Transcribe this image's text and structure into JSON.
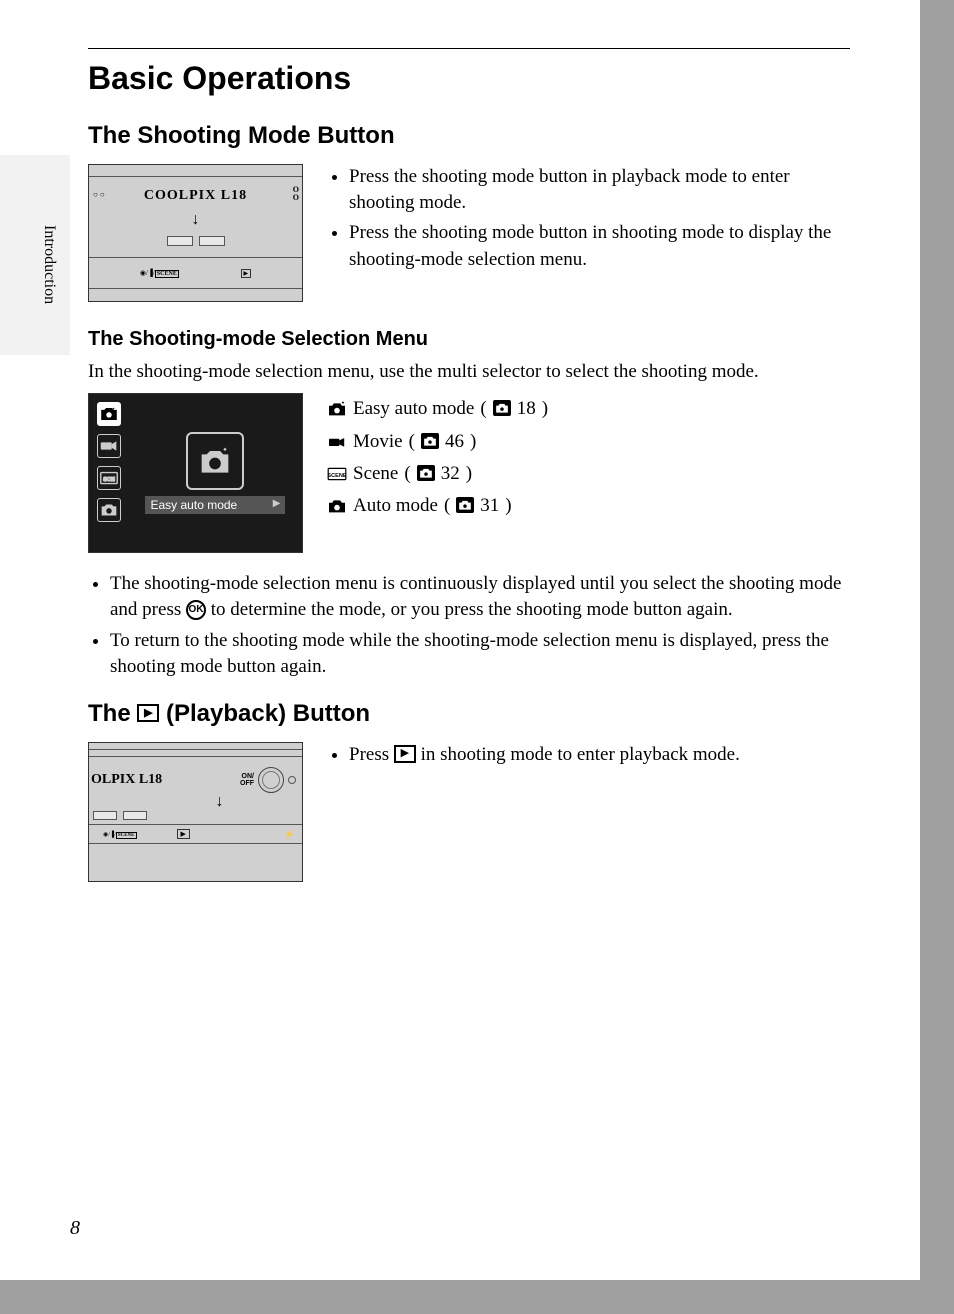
{
  "chapter_title": "Basic Operations",
  "side_tab": "Introduction",
  "page_number": "8",
  "section1": {
    "heading": "The Shooting Mode Button",
    "bullets": [
      "Press the shooting mode button in playback mode to enter shooting mode.",
      "Press the shooting mode button in shooting mode to display the shooting-mode selection menu."
    ],
    "illus_brand": "COOLPIX L18",
    "illus_oi": "O\nO",
    "illus_mode_label": "◉/▐/SCENE"
  },
  "subsection": {
    "heading": "The Shooting-mode Selection Menu",
    "intro": "In the shooting-mode selection menu, use the multi selector to select the shooting mode.",
    "screen_label": "Easy auto mode",
    "modes": [
      {
        "label": "Easy auto mode",
        "page": "18"
      },
      {
        "label": "Movie",
        "page": "46"
      },
      {
        "label": "Scene",
        "page": "32"
      },
      {
        "label": "Auto mode",
        "page": "31"
      }
    ],
    "post_bullets_a": "The shooting-mode selection menu is continuously displayed until you select the shooting mode and press ",
    "post_bullets_a2": " to determine the mode, or you press the shooting mode button again.",
    "post_bullets_b": "To return to the shooting mode while the shooting-mode selection menu is displayed, press the shooting mode button again.",
    "ok_label": "OK"
  },
  "section2": {
    "heading_pre": "The ",
    "heading_post": " (Playback) Button",
    "bullet_pre": "Press ",
    "bullet_post": " in shooting mode to enter playback mode.",
    "illus_brand": "OLPIX L18",
    "illus_onoff": "ON/\nOFF",
    "illus_mode_label": "◉/▐/SCENE"
  }
}
